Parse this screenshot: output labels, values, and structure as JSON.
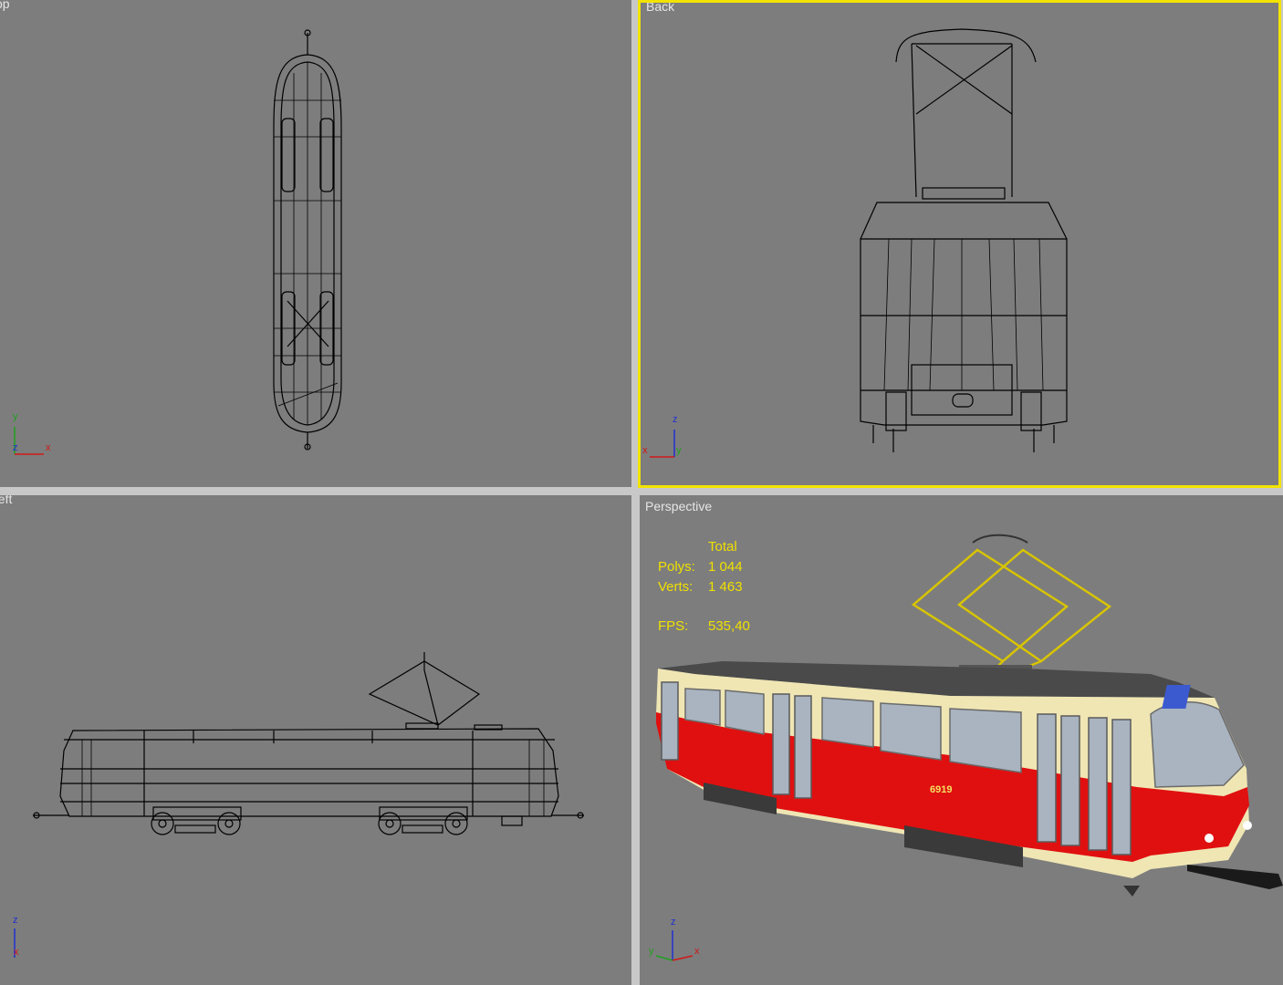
{
  "viewports": {
    "top": {
      "label": "Top"
    },
    "back": {
      "label": "Back"
    },
    "left": {
      "label": "Left"
    },
    "perspective": {
      "label": "Perspective"
    }
  },
  "stats": {
    "header": "Total",
    "polys_label": "Polys:",
    "polys_value": "1 044",
    "verts_label": "Verts:",
    "verts_value": "1 463",
    "fps_label": "FPS:",
    "fps_value": "535,40"
  },
  "tram_number": "6919",
  "colors": {
    "viewport_bg": "#7d7d7d",
    "active_border": "#f2e400",
    "stats_text": "#f0e000",
    "tram_red": "#e01010",
    "tram_cream": "#efe6b4",
    "axis_x": "#d01818",
    "axis_y": "#20a020",
    "axis_z": "#2030d0"
  }
}
